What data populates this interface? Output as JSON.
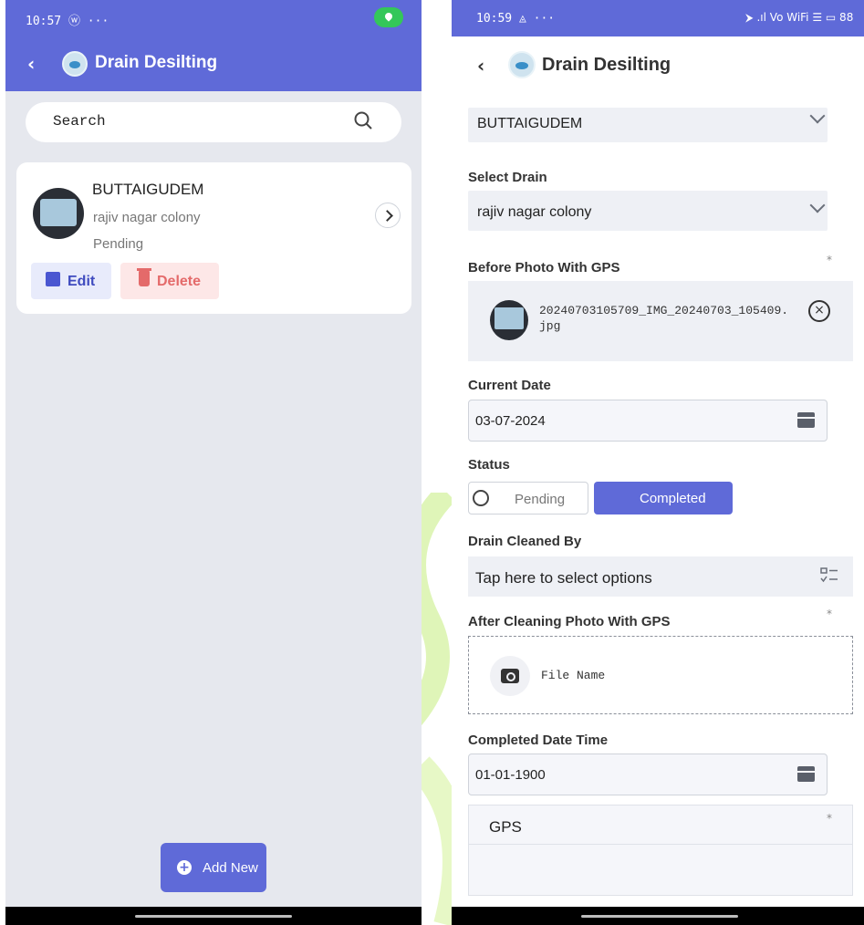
{
  "colors": {
    "primary": "#5f6ad8",
    "edit_bg": "#e8ebfb",
    "delete_bg": "#fde7e7",
    "delete_text": "#e46a6a",
    "status_green": "#34c759"
  },
  "left": {
    "status_time": "10:57 ⓦ ···",
    "title": "Drain Desilting",
    "search": {
      "placeholder": "Search"
    },
    "card": {
      "title": "BUTTAIGUDEM",
      "subtitle": "rajiv nagar colony",
      "status": "Pending",
      "edit_label": "Edit",
      "delete_label": "Delete"
    },
    "add_new_label": "Add New"
  },
  "right": {
    "status_time": "10:59 ◬ ···",
    "status_icons": "⮞ .ıl Vo WiFi ☰ ▭ 88",
    "title": "Drain Desilting",
    "village": {
      "value": "BUTTAIGUDEM"
    },
    "drain": {
      "label": "Select Drain",
      "value": "rajiv nagar colony"
    },
    "before_photo": {
      "label": "Before Photo With GPS",
      "file_name": "20240703105709_IMG_20240703_105409.jpg"
    },
    "current_date": {
      "label": "Current Date",
      "value": "03-07-2024"
    },
    "status": {
      "label": "Status",
      "options": [
        "Pending",
        "Completed"
      ],
      "selected": "Completed"
    },
    "cleaned_by": {
      "label": "Drain Cleaned By",
      "placeholder": "Tap here to select options"
    },
    "after_photo": {
      "label": "After Cleaning Photo With GPS",
      "placeholder": "File Name"
    },
    "completed_date": {
      "label": "Completed Date Time",
      "value": "01-01-1900"
    },
    "gps": {
      "label": "GPS"
    },
    "required_mark": "*"
  }
}
